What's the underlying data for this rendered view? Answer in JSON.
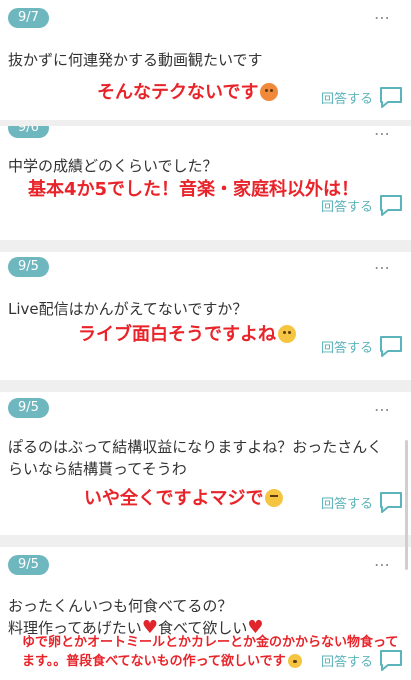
{
  "posts": [
    {
      "date": "9/7",
      "question": "抜かずに何連発かする動画観たいです",
      "answer": "そんなテクないです",
      "reply_label": "回答する",
      "emoji": "angry-face-icon"
    },
    {
      "date": "9/6",
      "question": "中学の成績どのくらいでした？",
      "answer": "基本4か5でした！音楽・家庭科以外は！",
      "reply_label": "回答する"
    },
    {
      "date": "9/5",
      "question": "Live配信はかんがえてないですか？",
      "answer": "ライブ面白そうですよね",
      "reply_label": "回答する",
      "emoji": "hand-over-mouth-emoji-icon"
    },
    {
      "date": "9/5",
      "question": "ぽるのはぶって結構収益になりますよね？おったさんくらいなら結構貰ってそうわ",
      "answer": "いや全くですよマジで",
      "reply_label": "回答する",
      "emoji": "expressionless-face-icon"
    },
    {
      "date": "9/5",
      "question_line1": "おったくんいつも何食べてるの？",
      "question_line2_a": "料理作ってあげたい",
      "question_line2_b": "食べて欲しい",
      "answer": "ゆで卵とかオートミールとかカレーとか金のかからない物食ってます。。普段食べてないもの作って欲しいです",
      "reply_label": "回答する",
      "emoji": "pleading-face-icon"
    }
  ],
  "more_icon": "⋯",
  "heart_icon": "♥",
  "colors": {
    "badge": "#6fb7bf",
    "accent": "#5bb3bb",
    "answer": "#e8242a",
    "separator": "#efefef"
  }
}
